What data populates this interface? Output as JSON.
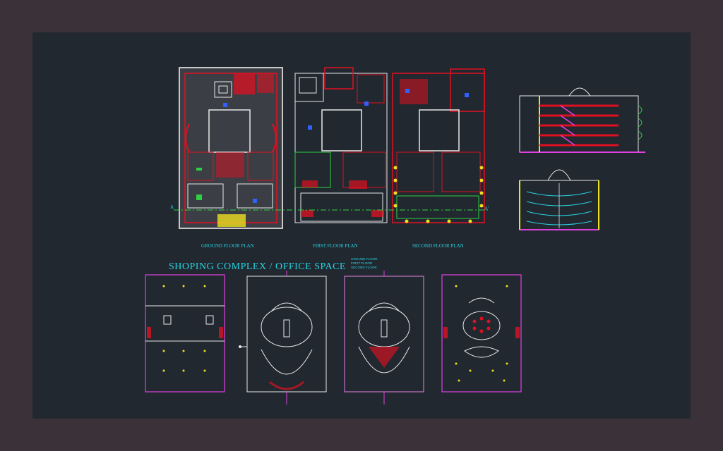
{
  "drawing": {
    "main_title": "SHOPING COMPLEX / OFFICE SPACE",
    "floor_legend": [
      "GROUND FLOOR",
      "FIRST FLOOR",
      "SECOND FLOOR"
    ],
    "plan_labels": {
      "ground": "GROUND FLOOR PLAN",
      "first": "FIRST FLOOR PLAN",
      "second": "SECOND FLOOR PLAN"
    },
    "section_marks": {
      "left": "A",
      "right": "A'"
    }
  },
  "colors": {
    "frame_bg": "#3a3139",
    "canvas_bg": "#212830",
    "text_cyan": "#29d3e0",
    "wall_white": "#e8e8e8",
    "red": "#e01020",
    "magenta": "#e040e0",
    "yellow": "#f0e020",
    "green": "#30d040",
    "blue": "#3060ff"
  }
}
